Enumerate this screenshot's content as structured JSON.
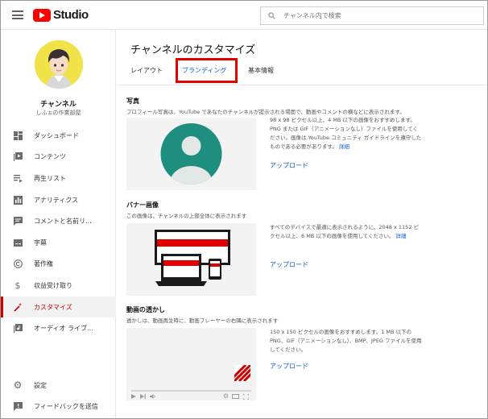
{
  "app": {
    "logo_text": "Studio",
    "search_placeholder": "チャンネル内で検索"
  },
  "channel": {
    "name": "チャンネル",
    "handle": "しふぉの作業部屋"
  },
  "sidebar": {
    "items": [
      {
        "label": "ダッシュボード",
        "icon": "dashboard-icon"
      },
      {
        "label": "コンテンツ",
        "icon": "content-icon"
      },
      {
        "label": "再生リスト",
        "icon": "playlist-icon"
      },
      {
        "label": "アナリティクス",
        "icon": "analytics-icon"
      },
      {
        "label": "コメントと名前リ...",
        "icon": "comments-icon"
      },
      {
        "label": "字幕",
        "icon": "subtitles-icon"
      },
      {
        "label": "著作権",
        "icon": "copyright-icon"
      },
      {
        "label": "収益受け取り",
        "icon": "monetization-icon"
      },
      {
        "label": "カスタマイズ",
        "icon": "customize-icon",
        "active": true
      },
      {
        "label": "オーディオ ライブ...",
        "icon": "audio-library-icon"
      }
    ],
    "bottom": [
      {
        "label": "設定",
        "icon": "settings-icon"
      },
      {
        "label": "フィードバックを送信",
        "icon": "feedback-icon"
      }
    ]
  },
  "main": {
    "title": "チャンネルのカスタマイズ",
    "tabs": [
      {
        "label": "レイアウト"
      },
      {
        "label": "ブランディング",
        "active": true
      },
      {
        "label": "基本情報"
      }
    ],
    "photo": {
      "title": "写真",
      "desc": "プロフィール写真は、YouTube であなたのチャンネルが提示される場面で、動画やコメントの横などに表示されます。",
      "info": "98 x 98 ピクセル以上、4 MB 以下の画像をおすすめします。PNG または GIF（アニメーションなし）ファイルを使用してください。画像は YouTube コミュニティ ガイドラインを遵守したものである必要があります。",
      "more": "詳細",
      "upload": "アップロード"
    },
    "banner": {
      "title": "バナー画像",
      "desc": "この画像は、チャンネルの上部全体に表示されます",
      "info": "すべてのデバイスで最適に表示されるように、2048 x 1152 ピクセル以上、6 MB 以下の画像を使用してください。",
      "more": "詳細",
      "upload": "アップロード"
    },
    "watermark": {
      "title": "動画の透かし",
      "desc": "透かしは、動画再生時に、動画プレーヤーの右隅に表示されます",
      "info": "150 x 150 ピクセルの画像をおすすめします。1 MB 以下の PNG、GIF（アニメーションなし）、BMP、JPEG ファイルを使用してください。",
      "upload": "アップロード"
    }
  },
  "colors": {
    "accent": "#065fd4",
    "active_red": "#cc0000",
    "highlight_box": "#e00000",
    "avatar_placeholder": "#1e8e7e",
    "avatar_bg": "#f1e24a"
  }
}
